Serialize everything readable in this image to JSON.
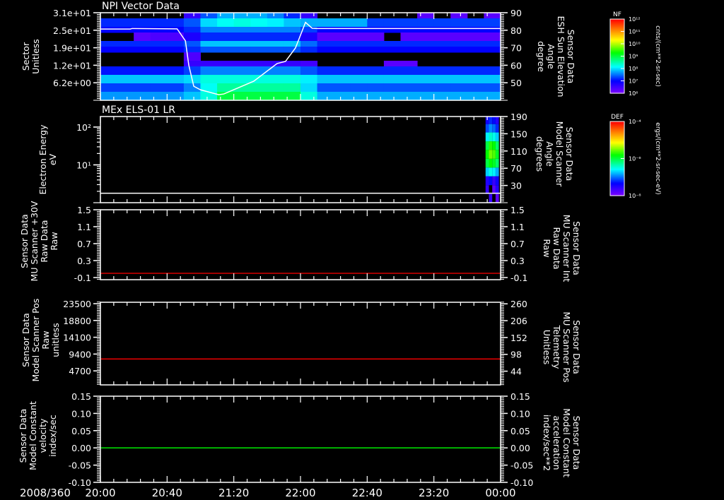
{
  "time_axis": {
    "date_label": "2008/360",
    "tick_labels": [
      "20:00",
      "20:40",
      "21:20",
      "22:00",
      "22:40",
      "23:20",
      "00:00"
    ],
    "range": [
      "20:00",
      "24:00"
    ]
  },
  "colors": {
    "axis": "#ffffff",
    "red": "#ff0000",
    "green": "#00ff00",
    "white_line": "#ffffff"
  },
  "chart_data": [
    {
      "type": "heatmap",
      "title": "NPI Vector Data",
      "ylabel_lines": [
        "Sector",
        "Unitless"
      ],
      "ylim": [
        0,
        31
      ],
      "ytick_values": [
        31,
        24.8,
        18.6,
        12.4,
        6.2
      ],
      "ytick_labels": [
        "3.1e+01",
        "2.5e+01",
        "1.9e+01",
        "1.2e+01",
        "6.2e+00"
      ],
      "time_columns": [
        "20:00",
        "20:10",
        "20:20",
        "20:30",
        "20:40",
        "20:50",
        "21:00",
        "21:10",
        "21:20",
        "21:30",
        "21:40",
        "21:50",
        "22:00",
        "22:10",
        "22:20",
        "22:30",
        "22:40",
        "22:50",
        "23:00",
        "23:10",
        "23:20",
        "23:30",
        "23:40",
        "23:50"
      ],
      "sector_bands": [
        [
          29,
          31
        ],
        [
          26,
          29
        ],
        [
          24,
          26
        ],
        [
          21,
          24
        ],
        [
          19,
          21
        ],
        [
          17,
          19
        ],
        [
          14,
          17
        ],
        [
          12,
          14
        ],
        [
          9,
          12
        ],
        [
          6,
          9
        ],
        [
          3,
          6
        ],
        [
          0,
          3
        ]
      ],
      "log10_values": [
        [
          null,
          null,
          null,
          null,
          null,
          6.6,
          7.4,
          7.8,
          7.8,
          7.8,
          7.6,
          7.2,
          6.6,
          null,
          null,
          null,
          null,
          null,
          null,
          6.3,
          null,
          6.3,
          null,
          6.3
        ],
        [
          7.2,
          7.2,
          7.2,
          7.2,
          7.2,
          7.4,
          8.0,
          8.2,
          8.3,
          8.2,
          8.1,
          7.9,
          7.8,
          7.8,
          7.8,
          7.8,
          7.3,
          7.3,
          7.3,
          7.3,
          7.3,
          7.3,
          7.3,
          7.3
        ],
        [
          7.0,
          7.0,
          7.0,
          7.0,
          7.0,
          7.2,
          7.6,
          7.6,
          7.6,
          7.6,
          7.6,
          7.6,
          7.3,
          7.0,
          7.0,
          7.0,
          7.0,
          7.0,
          7.0,
          7.0,
          7.0,
          7.0,
          7.0,
          7.0
        ],
        [
          null,
          null,
          6.3,
          6.4,
          6.4,
          6.8,
          7.2,
          7.2,
          7.2,
          7.2,
          7.2,
          7.2,
          6.8,
          6.3,
          6.3,
          6.3,
          6.3,
          null,
          6.3,
          6.3,
          6.3,
          6.3,
          6.3,
          6.3
        ],
        [
          7.2,
          7.2,
          7.2,
          7.2,
          7.2,
          7.4,
          7.9,
          7.9,
          7.9,
          7.9,
          7.9,
          7.9,
          7.5,
          7.2,
          7.2,
          7.2,
          7.2,
          7.2,
          7.2,
          7.2,
          7.2,
          7.2,
          7.2,
          7.2
        ],
        [
          7.0,
          7.0,
          7.0,
          7.0,
          7.0,
          7.2,
          7.4,
          7.4,
          7.4,
          7.4,
          7.4,
          7.4,
          7.2,
          7.0,
          7.0,
          7.0,
          7.0,
          7.0,
          7.0,
          7.0,
          7.0,
          7.0,
          7.0,
          7.0
        ],
        [
          null,
          null,
          null,
          null,
          null,
          6.4,
          null,
          null,
          null,
          null,
          null,
          null,
          null,
          null,
          null,
          null,
          null,
          null,
          null,
          null,
          null,
          null,
          null,
          null
        ],
        [
          null,
          null,
          null,
          null,
          null,
          6.6,
          6.6,
          6.6,
          6.6,
          6.6,
          6.6,
          6.6,
          6.5,
          null,
          null,
          null,
          null,
          6.3,
          6.3,
          null,
          null,
          null,
          null,
          null
        ],
        [
          7.1,
          7.1,
          7.1,
          7.1,
          7.1,
          7.3,
          7.6,
          7.6,
          7.6,
          7.6,
          7.6,
          7.6,
          7.4,
          7.2,
          7.2,
          7.2,
          7.2,
          7.2,
          7.2,
          7.2,
          7.2,
          7.2,
          7.2,
          7.2
        ],
        [
          7.9,
          7.9,
          7.9,
          7.9,
          7.9,
          8.0,
          8.3,
          8.3,
          8.3,
          8.3,
          8.3,
          8.3,
          8.1,
          7.9,
          7.9,
          7.9,
          7.9,
          7.9,
          7.9,
          7.9,
          7.9,
          7.9,
          7.9,
          7.9
        ],
        [
          7.3,
          7.3,
          7.3,
          7.3,
          7.3,
          7.6,
          8.2,
          8.6,
          8.6,
          8.6,
          8.6,
          8.6,
          8.0,
          7.4,
          7.4,
          7.4,
          7.4,
          7.4,
          7.4,
          7.4,
          7.4,
          7.4,
          7.4,
          7.4
        ],
        [
          7.7,
          7.7,
          7.7,
          7.7,
          7.7,
          7.9,
          8.3,
          9.0,
          9.0,
          9.0,
          9.0,
          9.0,
          8.3,
          7.8,
          7.8,
          7.8,
          7.8,
          7.8,
          7.8,
          7.8,
          7.8,
          7.8,
          7.8,
          7.8
        ]
      ],
      "colorbar": {
        "label": "NF",
        "units": "cnts/(cm**2-sr-sec)",
        "log_range": [
          6,
          12
        ],
        "tick_labels": [
          "10¹²",
          "10¹¹",
          "10¹⁰",
          "10⁹",
          "10⁸",
          "10⁷",
          "10⁶"
        ]
      },
      "overlay": {
        "type": "line",
        "ylabel_lines": [
          "Sensor Data",
          "ESH Sun Elevation",
          "Angle",
          "degree"
        ],
        "ylim": [
          40,
          90
        ],
        "ytick_labels": [
          "90",
          "80",
          "70",
          "60",
          "50"
        ],
        "ytick_values": [
          90,
          80,
          70,
          60,
          50
        ],
        "x": [
          "20:00",
          "20:18",
          "20:19",
          "20:46",
          "20:51",
          "20:53",
          "20:56",
          "21:00",
          "21:11",
          "21:14",
          "21:32",
          "21:46",
          "21:51",
          "21:57",
          "22:03",
          "22:07",
          "22:10",
          "24:00"
        ],
        "y": [
          80.7,
          80.7,
          81.0,
          80.8,
          73.9,
          60.1,
          48.0,
          46.0,
          43.2,
          43.6,
          50.9,
          61.0,
          62.2,
          69.9,
          84.5,
          81.1,
          81.0,
          81.0
        ]
      }
    },
    {
      "type": "heatmap",
      "title": "MEx ELS-01 LR",
      "ylabel_lines": [
        "Electron Energy",
        "eV"
      ],
      "yscale": "log",
      "ylim": [
        1,
        190
      ],
      "ytick_values": [
        100,
        10
      ],
      "ytick_labels": [
        "10²",
        "10¹"
      ],
      "time_columns": [
        "23:51",
        "23:53",
        "23:55",
        "23:57",
        "23:59"
      ],
      "energy_edges": [
        1,
        1.7,
        2.9,
        5,
        8.5,
        14.5,
        25,
        42,
        72,
        120,
        190
      ],
      "log10_values": [
        [
          null,
          -7.6,
          null,
          -7.8
        ],
        [
          -7.6,
          null,
          -7.8,
          -7.5
        ],
        [
          -7.5,
          -7.3,
          -7.6,
          -7.4
        ],
        [
          -6.7,
          -6.5,
          -6.6,
          -6.8
        ],
        [
          -6.0,
          -5.8,
          -5.9,
          -6.1
        ],
        [
          -5.8,
          -5.5,
          -5.6,
          -5.9
        ],
        [
          -6.0,
          -5.7,
          -5.8,
          -6.1
        ],
        [
          -6.6,
          -6.4,
          -6.5,
          -6.7
        ],
        [
          -7.1,
          -6.9,
          -7.0,
          -7.2
        ],
        [
          -7.4,
          -7.2,
          -7.3,
          -7.5
        ]
      ],
      "colorbar": {
        "label": "DEF",
        "units": "ergs/(cm**2-sr-sec-eV)",
        "log_range": [
          -8,
          -4
        ],
        "tick_labels": [
          "10⁻⁴",
          "10⁻⁶",
          "10⁻⁸"
        ]
      },
      "overlay": {
        "type": "line",
        "ylabel_lines": [
          "Sensor Data",
          "Model Scanner",
          "Angle",
          "degrees"
        ],
        "ylim": [
          -10,
          190
        ],
        "ytick_values": [
          190,
          150,
          110,
          70,
          30
        ],
        "ytick_labels": [
          "190",
          "150",
          "110",
          "70",
          "30"
        ],
        "x": [
          "20:00",
          "24:00"
        ],
        "y": [
          12,
          12
        ]
      }
    },
    {
      "type": "line",
      "ylabel_lines": [
        "Sensor Data",
        "MU Scanner +30V",
        "Raw Data",
        "Raw"
      ],
      "ylim": [
        -0.15,
        1.5
      ],
      "ytick_values": [
        1.5,
        1.1,
        0.7,
        0.3,
        -0.1
      ],
      "ytick_labels": [
        "1.5",
        "1.1",
        "0.7",
        "0.3",
        "-0.1"
      ],
      "series": [
        {
          "color": "#ff0000",
          "x": [
            "20:00",
            "24:00"
          ],
          "y": [
            0,
            0
          ]
        }
      ],
      "right_axis": {
        "ylabel_lines": [
          "Sensor Data",
          "MU Scanner Int",
          "Raw Data",
          "Raw"
        ],
        "label_color": "#ff0000",
        "ylim": [
          -0.15,
          1.5
        ],
        "ytick_values": [
          1.5,
          1.1,
          0.7,
          0.3,
          -0.1
        ],
        "ytick_labels": [
          "1.5",
          "1.1",
          "0.7",
          "0.3",
          "-0.1"
        ]
      }
    },
    {
      "type": "line",
      "ylabel_lines": [
        "Sensor Data",
        "Model Scanner Pos",
        "Raw",
        "unitless"
      ],
      "ylim": [
        780,
        23890
      ],
      "ytick_values": [
        23500,
        18800,
        14100,
        9400,
        4700
      ],
      "ytick_labels": [
        "23500",
        "18800",
        "14100",
        "9400",
        "4700"
      ],
      "series": [
        {
          "color": "#ff0000",
          "x": [
            "20:00",
            "24:00"
          ],
          "y": [
            8030,
            8030
          ]
        }
      ],
      "right_axis": {
        "ylabel_lines": [
          "Sensor Data",
          "MU Scanner Pos",
          "Telemetry",
          "Unitless"
        ],
        "label_color": "#ff0000",
        "ylim": [
          0,
          265
        ],
        "ytick_values": [
          260,
          206,
          152,
          98,
          44
        ],
        "ytick_labels": [
          "260",
          "206",
          "152",
          "98",
          "44"
        ]
      }
    },
    {
      "type": "line",
      "ylabel_lines": [
        "Sensor Data",
        "Model Constant",
        "velocity",
        "index/sec"
      ],
      "ylim": [
        -0.1,
        0.15
      ],
      "ytick_values": [
        0.15,
        0.1,
        0.05,
        0.0,
        -0.05,
        -0.1
      ],
      "ytick_labels": [
        "0.15",
        "0.10",
        "0.05",
        "0.00",
        "-0.05",
        "-0.10"
      ],
      "series": [
        {
          "color": "#00ff00",
          "x": [
            "20:00",
            "24:00"
          ],
          "y": [
            0,
            0
          ]
        }
      ],
      "right_axis": {
        "ylabel_lines": [
          "Sensor Data",
          "Model Constant",
          "acceleration",
          "index/sec**2"
        ],
        "label_color": "#00ff00",
        "ylim": [
          -0.1,
          0.15
        ],
        "ytick_values": [
          0.15,
          0.1,
          0.05,
          0.0,
          -0.05,
          -0.1
        ],
        "ytick_labels": [
          "0.15",
          "0.10",
          "0.05",
          "0.00",
          "-0.05",
          "-0.10"
        ]
      }
    }
  ]
}
